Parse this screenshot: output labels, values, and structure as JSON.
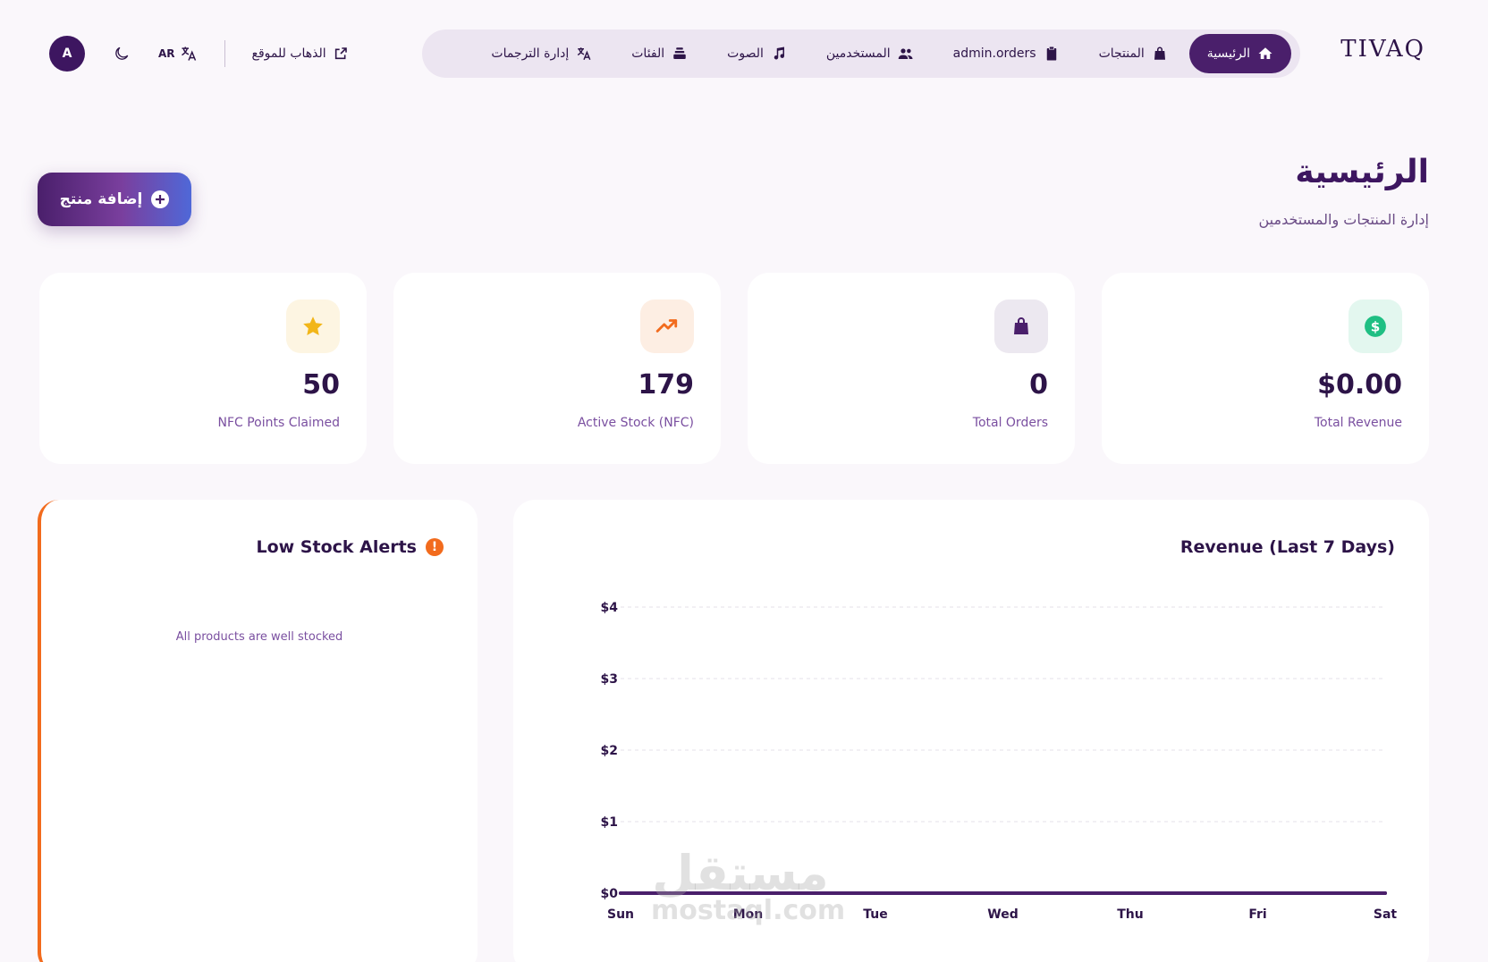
{
  "header": {
    "brand": "TIVAQ",
    "nav": [
      {
        "label": "الرئيسية",
        "icon": "home-icon",
        "active": true
      },
      {
        "label": "المنتجات",
        "icon": "shopping-bag-icon",
        "active": false
      },
      {
        "label": "admin.orders",
        "icon": "clipboard-icon",
        "active": false
      },
      {
        "label": "المستخدمين",
        "icon": "users-icon",
        "active": false
      },
      {
        "label": "الصوت",
        "icon": "music-note-icon",
        "active": false
      },
      {
        "label": "الفئات",
        "icon": "layers-icon",
        "active": false
      },
      {
        "label": "إدارة الترجمات",
        "icon": "translate-icon",
        "active": false
      }
    ],
    "goto_site": "الذهاب للموقع",
    "language": "AR",
    "avatar_initial": "A"
  },
  "page": {
    "title": "الرئيسية",
    "subtitle": "إدارة المنتجات والمستخدمين",
    "add_product": "إضافة منتج"
  },
  "stats": [
    {
      "value": "$0.00",
      "label": "Total Revenue",
      "icon": "dollar-icon",
      "color": "#1fbf83",
      "bg": "#e3f7ef"
    },
    {
      "value": "0",
      "label": "Total Orders",
      "icon": "shopping-bag-icon",
      "color": "#4a1f6b",
      "bg": "#ece8f0"
    },
    {
      "value": "179",
      "label": "Active Stock (NFC)",
      "icon": "trending-up-icon",
      "color": "#f26b1d",
      "bg": "#fdeee3"
    },
    {
      "value": "50",
      "label": "NFC Points Claimed",
      "icon": "star-icon",
      "color": "#f2b619",
      "bg": "#fdf5e2"
    }
  ],
  "low_stock": {
    "title": "Low Stock Alerts",
    "empty_message": "All products are well stocked",
    "accent": "#f26b1d"
  },
  "chart_data": {
    "type": "line",
    "title": "Revenue (Last 7 Days)",
    "categories": [
      "Sun",
      "Mon",
      "Tue",
      "Wed",
      "Thu",
      "Fri",
      "Sat"
    ],
    "values": [
      0,
      0,
      0,
      0,
      0,
      0,
      0
    ],
    "y_ticks": [
      "$0",
      "$1",
      "$2",
      "$3",
      "$4"
    ],
    "ylim": [
      0,
      4
    ],
    "grid": true,
    "line_color": "#4a1f6b"
  },
  "watermark": {
    "arabic": "مستقل",
    "latin": "mostaql.com"
  }
}
